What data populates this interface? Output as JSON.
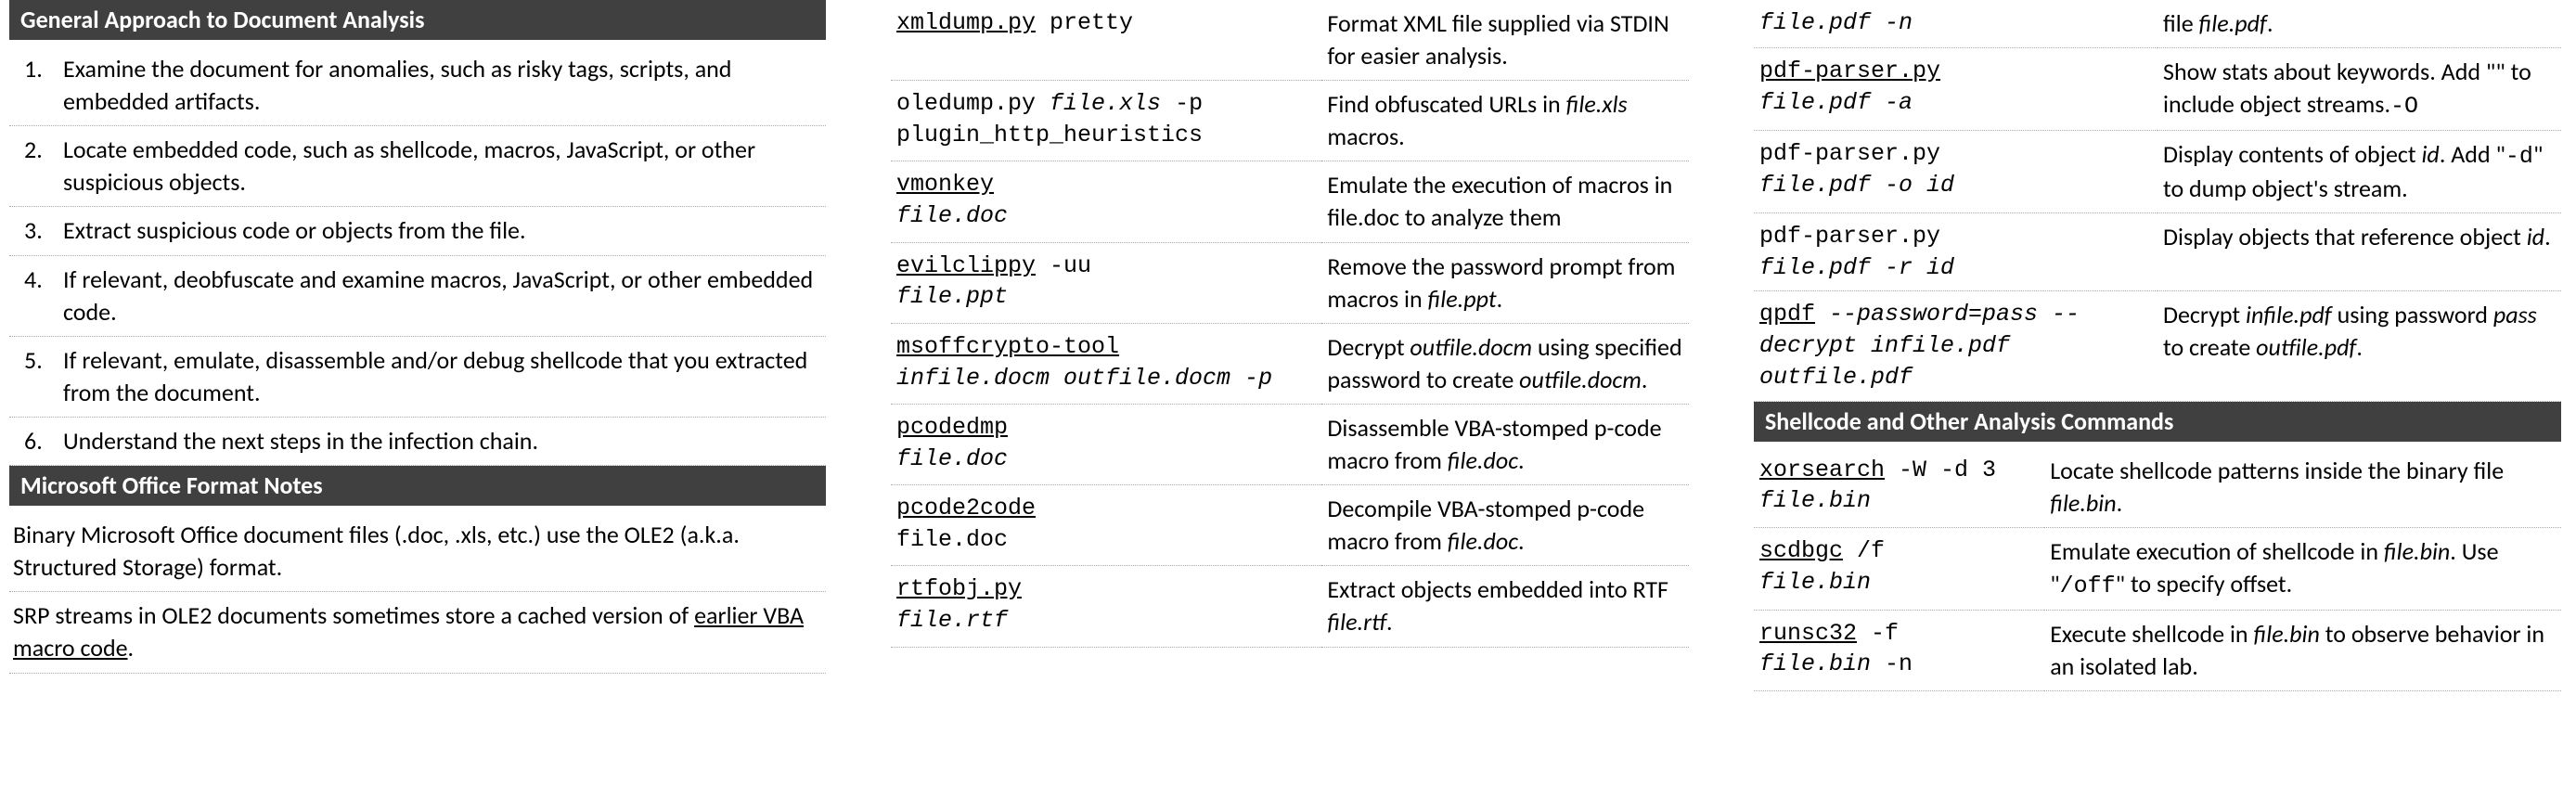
{
  "col1": {
    "header1": "General Approach to Document Analysis",
    "steps": [
      "Examine the document for anomalies, such as risky tags, scripts, and embedded artifacts.",
      "Locate embedded code, such as shellcode, macros, JavaScript, or other suspicious objects.",
      "Extract suspicious code or objects from the file.",
      "If relevant, deobfuscate and examine macros, JavaScript, or other embedded code.",
      "If relevant, emulate, disassemble and/or debug shellcode that you extracted from the document.",
      "Understand the next steps in the infection chain."
    ],
    "header2": "Microsoft Office Format Notes",
    "note1": "Binary Microsoft Office document files (.doc, .xls, etc.) use the OLE2 (a.k.a. Structured Storage) format.",
    "note2_a": "SRP streams in OLE2 documents sometimes store a cached version of ",
    "note2_b": "earlier VBA macro code",
    "note2_c": "."
  },
  "col2_rows": [
    {
      "tool": "xmldump.py",
      "rest": " pretty",
      "widthA": "40%",
      "desc": "Format XML file supplied via STDIN for easier analysis."
    },
    {
      "plain": true,
      "widthA": "54%",
      "cmd_a": "oledump.py ",
      "arg": "file.xls",
      "cmd_b": " -p plugin_http_heuristics",
      "desc_a": "Find obfuscated URLs in ",
      "emph": "file.xls",
      "desc_b": " macros."
    },
    {
      "tool": "vmonkey",
      "arg": "file.doc",
      "nl": true,
      "widthA": "40%",
      "desc": "Emulate the execution of macros in file.doc to analyze them"
    },
    {
      "tool": "evilclippy",
      "rest": " -uu",
      "arg": "file.ppt",
      "nl": true,
      "widthA": "36%",
      "desc_a": "Remove the password prompt from macros in ",
      "emph": "file.ppt",
      "desc_b": "."
    },
    {
      "tool": "msoffcrypto-tool",
      "argline": "infile.docm outfile.docm -p",
      "widthA": "44%",
      "desc_a": "Decrypt ",
      "emph": "outfile.docm",
      "desc_b": " using specified password to create ",
      "emph2": "outfile.docm",
      "desc_c": "."
    },
    {
      "tool": "pcodedmp",
      "arg": "file.doc",
      "nl": true,
      "widthA": "44%",
      "desc_a": "Disassemble VBA-stomped p-code macro from ",
      "emph": "file.doc",
      "desc_b": "."
    },
    {
      "tool": "pcode2code",
      "plainarg": "file.doc",
      "nl": true,
      "widthA": "44%",
      "desc_a": "Decompile VBA-stomped p-code macro from ",
      "emph": "file.doc",
      "desc_b": "."
    },
    {
      "tool": "rtfobj.py",
      "arg": "file.rtf",
      "nl": true,
      "widthA": "44%",
      "desc_a": "Extract objects embedded into RTF ",
      "emph": "file.rtf",
      "desc_b": "."
    }
  ],
  "col3_top": [
    {
      "argline": "file.pdf -n",
      "widthA": "36%",
      "desc_a": "file ",
      "emph": "file.pdf",
      "desc_b": "."
    },
    {
      "tool": "pdf-parser.py",
      "argline": "file.pdf -a",
      "widthA": "36%",
      "desc_a": "Show stats about keywords. Add \"",
      "mono": "-O",
      "desc_b": "\" to include object streams."
    },
    {
      "plain_prefix": "pdf-parser.py ",
      "argline_a": "file.pdf -o ",
      "arg": "id",
      "widthA": "36%",
      "desc_a": "Display contents of object ",
      "emph": "id",
      "desc_b": ". Add \"",
      "mono": "-d",
      "desc_c": "\" to dump object's stream."
    },
    {
      "plain_prefix": "pdf-parser.py ",
      "argline_a": "file.pdf -r ",
      "arg": "id",
      "widthA": "48%",
      "desc_a": "Display objects that reference object ",
      "emph": "id",
      "desc_b": "."
    },
    {
      "tool": "qpdf",
      "ital_rest": " --password=pass --decrypt infile.pdf outfile.pdf",
      "widthA": "50%",
      "desc_a": "Decrypt ",
      "emph": "infile.pdf",
      "desc_b": " using password ",
      "emph2": "pass",
      "desc_c": " to create ",
      "emph3": "outfile.pdf",
      "desc_d": "."
    }
  ],
  "col3_header": "Shellcode and Other Analysis Commands",
  "col3_bottom": [
    {
      "tool": "xorsearch",
      "rest": " -W -d 3 ",
      "arg": "file.bin",
      "widthA": "36%",
      "desc_a": "Locate shellcode patterns inside the binary file ",
      "emph": "file.bin",
      "desc_b": "."
    },
    {
      "tool": "scdbgc",
      "rest": " /f ",
      "arg": "file.bin",
      "nl": true,
      "widthA": "30%",
      "desc_a": "Emulate execution of shellcode in ",
      "emph": "file.bin",
      "desc_b": ". Use \"",
      "mono": "/off",
      "desc_c": "\" to specify offset."
    },
    {
      "tool": "runsc32",
      "rest": " -f ",
      "arg": "file.bin",
      "rest2": " -n",
      "nl": true,
      "widthA": "30%",
      "desc_a": "Execute shellcode in ",
      "emph": "file.bin",
      "desc_b": " to observe behavior in an isolated lab."
    }
  ]
}
